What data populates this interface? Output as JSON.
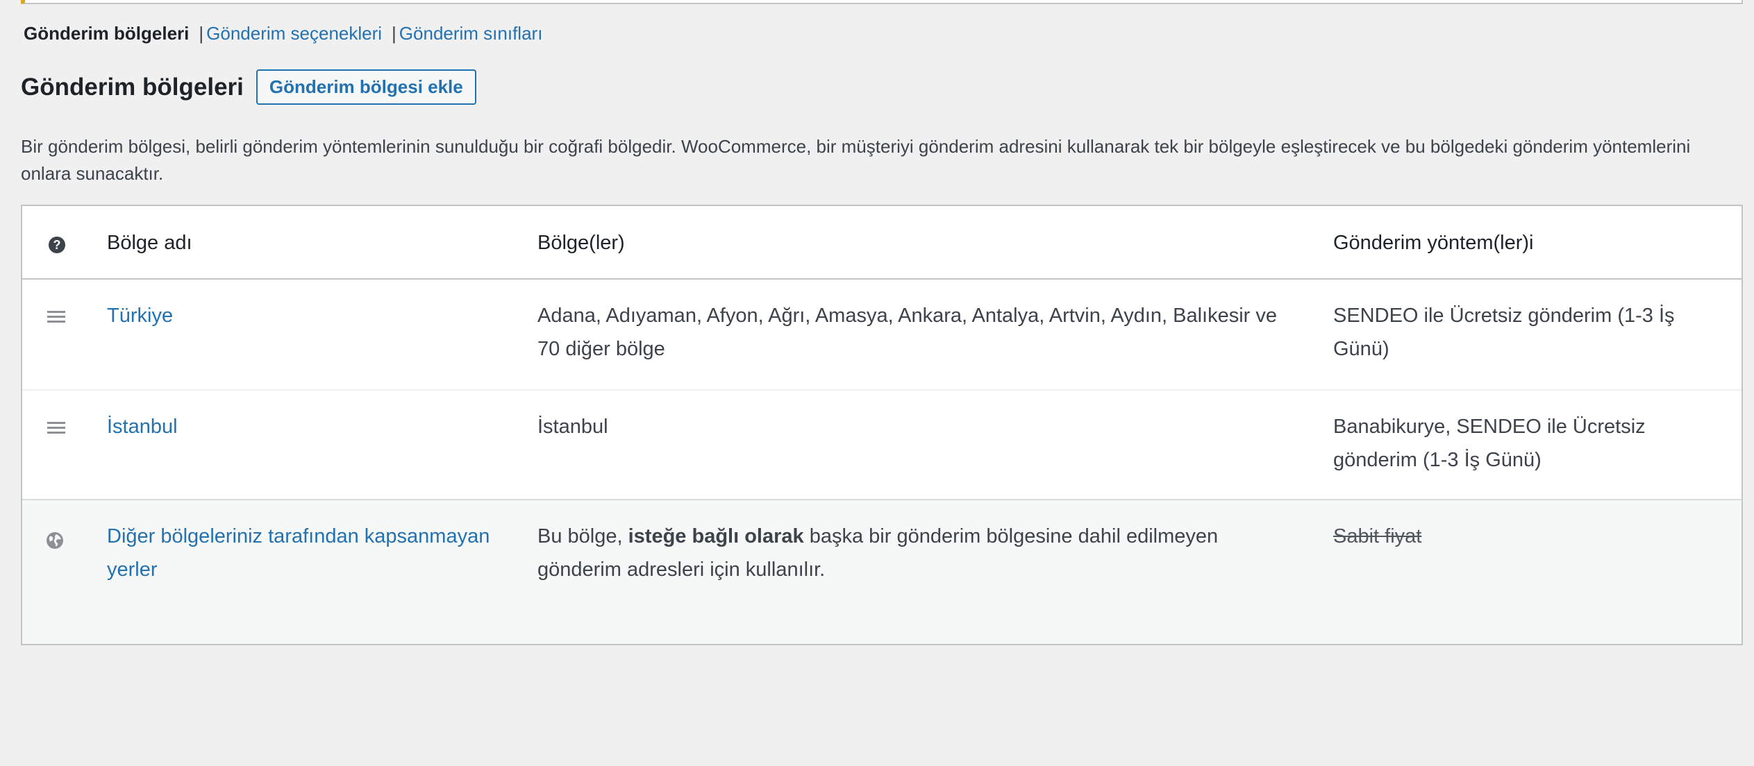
{
  "tabs": {
    "current": "Gönderim bölgeleri",
    "separator": "|",
    "options": "Gönderim seçenekleri",
    "classes": "Gönderim sınıfları"
  },
  "heading": {
    "title": "Gönderim bölgeleri",
    "add_button": "Gönderim bölgesi ekle"
  },
  "description": "Bir gönderim bölgesi, belirli gönderim yöntemlerinin sunulduğu bir coğrafi bölgedir. WooCommerce, bir müşteriyi gönderim adresini kullanarak tek bir bölgeyle eşleştirecek ve bu bölgedeki gönderim yöntemlerini onlara sunacaktır.",
  "table": {
    "headers": {
      "help_glyph": "?",
      "name": "Bölge adı",
      "regions": "Bölge(ler)",
      "methods": "Gönderim yöntem(ler)i"
    },
    "rows": [
      {
        "name": "Türkiye",
        "regions": "Adana, Adıyaman, Afyon, Ağrı, Amasya, Ankara, Antalya, Artvin, Aydın, Balıkesir ve 70 diğer bölge",
        "methods": "SENDEO ile Ücretsiz gönderim (1-3 İş Günü)"
      },
      {
        "name": "İstanbul",
        "regions": "İstanbul",
        "methods": "Banabikurye, SENDEO ile Ücretsiz gönderim (1-3 İş Günü)"
      }
    ],
    "rest_of_world": {
      "name": "Diğer bölgeleriniz tarafından kapsanmayan yerler",
      "regions_prefix": "Bu bölge, ",
      "regions_bold": "isteğe bağlı olarak",
      "regions_suffix": " başka bir gönderim bölgesine dahil edilmeyen gönderim adresleri için kullanılır.",
      "method": "Sabit fiyat"
    }
  },
  "colors": {
    "link": "#2271b1",
    "text": "#3c434a",
    "background": "#f0f0f1",
    "notice_accent": "#dba617"
  }
}
